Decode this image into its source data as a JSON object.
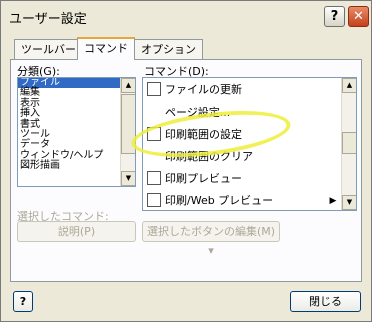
{
  "window": {
    "title": "ユーザー設定",
    "help_glyph": "?",
    "close_glyph": "✕"
  },
  "tabs": [
    {
      "label": "ツールバー",
      "active": false
    },
    {
      "label": "コマンド",
      "active": true
    },
    {
      "label": "オプション",
      "active": false
    }
  ],
  "categories": {
    "label": "分類(G):",
    "items": [
      "ファイル",
      "編集",
      "表示",
      "挿入",
      "書式",
      "ツール",
      "データ",
      "ウィンドウ/ヘルプ",
      "図形描画"
    ],
    "selected": "ファイル"
  },
  "commands": {
    "label": "コマンド(D):",
    "items": [
      {
        "label": "ファイルの更新",
        "icon": "refresh-file-icon"
      },
      {
        "label": "ページ設定...",
        "icon": "none"
      },
      {
        "label": "印刷範囲の設定",
        "icon": "print-area-icon"
      },
      {
        "label": "印刷範囲のクリア",
        "icon": "none"
      },
      {
        "label": "印刷プレビュー",
        "icon": "print-preview-icon"
      },
      {
        "label": "印刷/Web プレビュー",
        "icon": "web-preview-icon",
        "has_submenu": true
      }
    ],
    "highlight_color": "#efef3a"
  },
  "selected_command": {
    "label": "選択したコマンド:",
    "description_button": "説明(P)",
    "modify_button": "選択したボタンの編集(M) ▾"
  },
  "footer": {
    "help_glyph": "?",
    "close_button": "閉じる"
  },
  "colors": {
    "window_bg": "#ece9d8",
    "selection": "#316ac5",
    "tab_accent": "#e6a83a"
  }
}
